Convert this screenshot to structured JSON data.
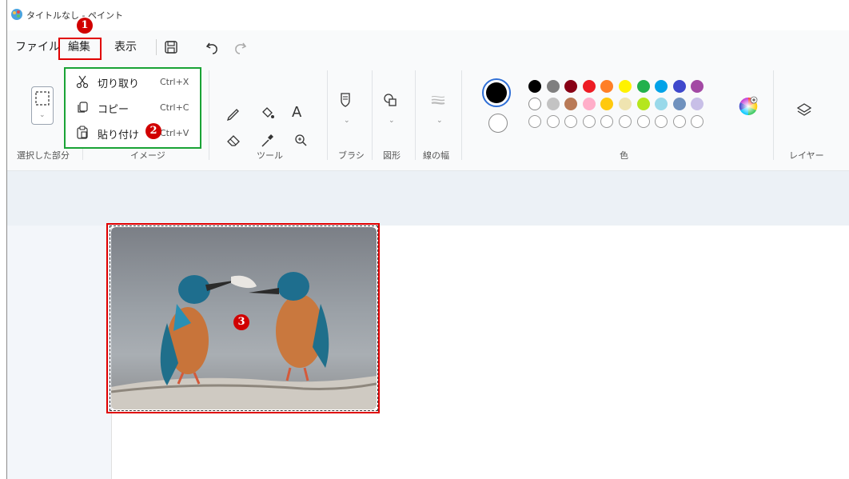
{
  "titlebar": {
    "title": "タイトルなし - ペイント"
  },
  "menu": {
    "file": "ファイル",
    "edit": "編集",
    "view": "表示"
  },
  "quick_access": [
    "save-icon",
    "undo-icon",
    "redo-icon"
  ],
  "edit_menu": {
    "items": [
      {
        "label": "切り取り",
        "shortcut": "Ctrl+X",
        "icon": "scissors-icon"
      },
      {
        "label": "コピー",
        "shortcut": "Ctrl+C",
        "icon": "copy-icon"
      },
      {
        "label": "貼り付け",
        "shortcut": "Ctrl+V",
        "icon": "paste-icon"
      }
    ]
  },
  "ribbon": {
    "groups": {
      "selection": "選択した部分",
      "image": "イメージ",
      "tools": "ツール",
      "brush": "ブラシ",
      "shapes": "図形",
      "stroke": "線の幅",
      "colors": "色",
      "layers": "レイヤー"
    },
    "tools": [
      "pencil-icon",
      "fill-icon",
      "text-icon",
      "eraser-icon",
      "color-picker-icon",
      "magnifier-icon"
    ],
    "text_tool_glyph": "A"
  },
  "palette": {
    "current_primary": "#000000",
    "current_secondary": "#ffffff",
    "row1": [
      "#000000",
      "#7f7f7f",
      "#880015",
      "#ed1c24",
      "#ff7f27",
      "#fff200",
      "#22b14c",
      "#00a2e8",
      "#3f48cc",
      "#a349a4"
    ],
    "row2": [
      "#ffffff",
      "#c3c3c3",
      "#b97a57",
      "#ffaec9",
      "#ffc90e",
      "#efe4b0",
      "#b5e61d",
      "#99d9ea",
      "#7092be",
      "#c8bfe7"
    ],
    "row3_empty_count": "10"
  },
  "annotations": {
    "step1": "1",
    "step2": "2",
    "step3": "3"
  },
  "canvas": {
    "pasted_image": "kingfishers-photo"
  }
}
